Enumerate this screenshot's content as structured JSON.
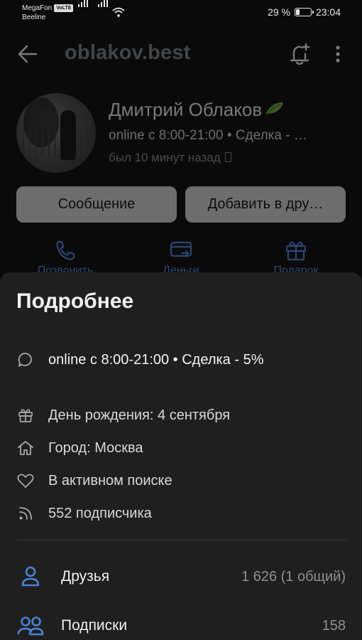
{
  "status_bar": {
    "carrier_1": "MegaFon",
    "volte_badge": "VoLTE",
    "carrier_2": "Beeline",
    "battery_percent": "29 %",
    "battery_level": 0.29,
    "time": "23:04"
  },
  "header": {
    "title": "oblakov.best",
    "back_icon": "arrow-left-icon",
    "bell_icon": "bell-plus-icon",
    "more_icon": "more-vertical-icon"
  },
  "profile": {
    "name": "Дмитрий Облаков",
    "status": "online с 8:00-21:00  •  Сделка - …",
    "last_seen": "был 10 минут назад",
    "message_button": "Сообщение",
    "add_friend_button": "Добавить в дру…",
    "actions": [
      {
        "label": "Позвонить",
        "icon": "phone-icon"
      },
      {
        "label": "Деньги",
        "icon": "money-transfer-icon"
      },
      {
        "label": "Подарок",
        "icon": "gift-icon"
      }
    ]
  },
  "details": {
    "title": "Подробнее",
    "status_text": "online с 8:00-21:00  •  Сделка - 5%",
    "birthday": "День рождения: 4 сентября",
    "city": "Город: Москва",
    "relationship": "В активном поиске",
    "followers": "552 подписчика",
    "friends_label": "Друзья",
    "friends_value": "1 626 (1 общий)",
    "subscriptions_label": "Подписки",
    "subscriptions_value": "158"
  },
  "colors": {
    "accent": "#4a84d6",
    "sheet_background": "#1f1f1f",
    "page_background": "#0a0a0a"
  }
}
